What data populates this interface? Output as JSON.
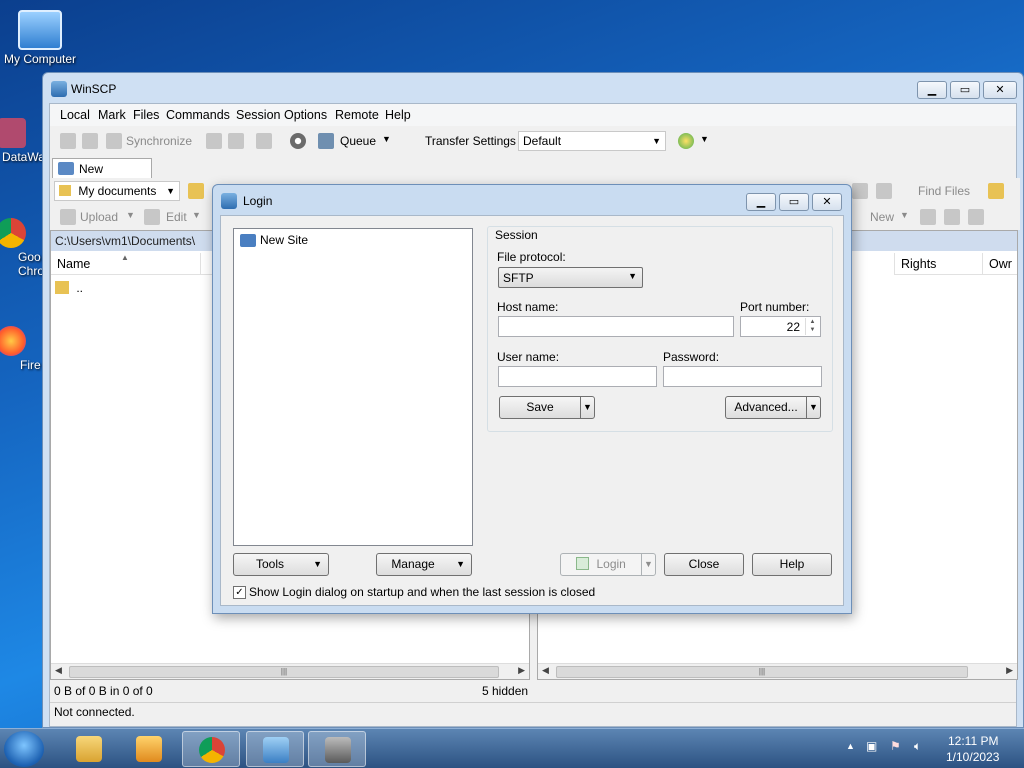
{
  "desktop": {
    "icons": [
      {
        "label": "My Computer"
      },
      {
        "label": "DataWa"
      },
      {
        "label": "Goo Chro"
      },
      {
        "label": "Fire"
      }
    ]
  },
  "winscp": {
    "title": "WinSCP",
    "menu": [
      "Local",
      "Mark",
      "Files",
      "Commands",
      "Session",
      "Options",
      "Remote",
      "Help"
    ],
    "toolbar": {
      "synchronize": "Synchronize",
      "queue": "Queue",
      "transfer_settings_label": "Transfer Settings",
      "transfer_settings_value": "Default"
    },
    "tab": "New Session",
    "left_panel": {
      "location": "My documents",
      "upload": "Upload",
      "edit": "Edit",
      "path": "C:\\Users\\vm1\\Documents\\",
      "col_name": "Name",
      "parent_dir": "..",
      "status_left": "0 B of 0 B in 0 of 0",
      "status_right": "5 hidden"
    },
    "right_panel": {
      "find_files": "Find Files",
      "new": "New",
      "col_rights": "Rights",
      "col_owner": "Owr"
    },
    "status": "Not connected."
  },
  "login": {
    "title": "Login",
    "site_tree": [
      "New Site"
    ],
    "session_group": "Session",
    "file_protocol_label": "File protocol:",
    "file_protocol_value": "SFTP",
    "host_label": "Host name:",
    "host_value": "",
    "port_label": "Port number:",
    "port_value": "22",
    "user_label": "User name:",
    "user_value": "",
    "password_label": "Password:",
    "password_value": "",
    "save": "Save",
    "advanced": "Advanced...",
    "tools": "Tools",
    "manage": "Manage",
    "login": "Login",
    "close": "Close",
    "help": "Help",
    "startup_checkbox": "Show Login dialog on startup and when the last session is closed",
    "startup_checked": true
  },
  "taskbar": {
    "time": "12:11 PM",
    "date": "1/10/2023"
  },
  "colors": {
    "desktop": "#1565c0",
    "window_frame": "#c9dcf1",
    "path_bar": "#cfdcee",
    "taskbar": "#2c5282"
  }
}
